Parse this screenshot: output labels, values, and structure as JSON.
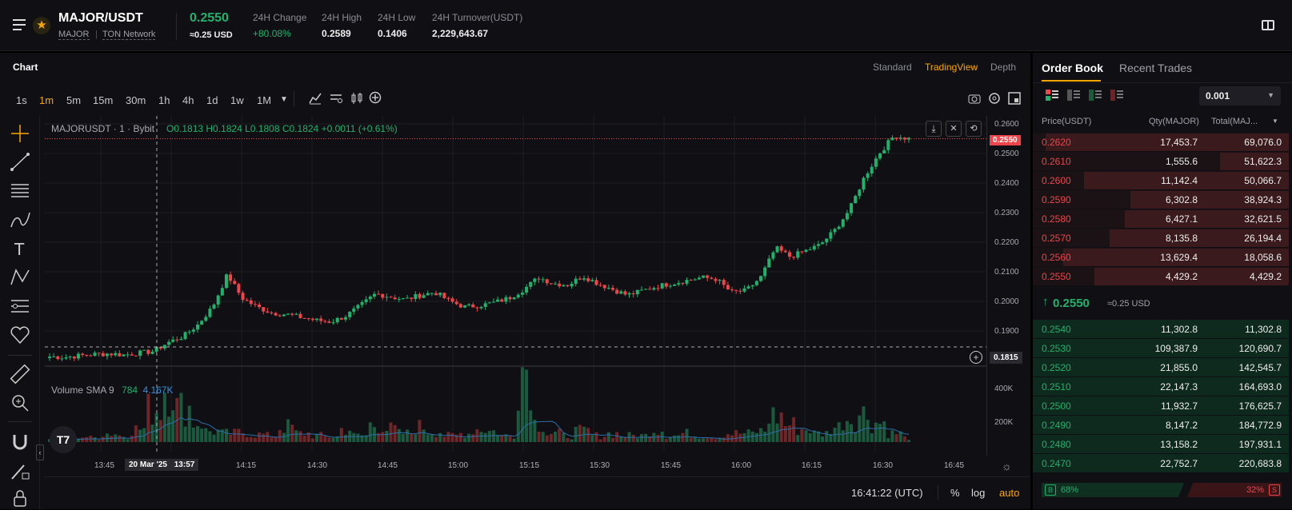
{
  "header": {
    "pair": "MAJOR/USDT",
    "base_name": "MAJOR",
    "network": "TON Network",
    "price": "0.2550",
    "price_usd": "≈0.25 USD",
    "stats": [
      {
        "label": "24H Change",
        "value": "+80.08%"
      },
      {
        "label": "24H High",
        "value": "0.2589"
      },
      {
        "label": "24H Low",
        "value": "0.1406"
      },
      {
        "label": "24H Turnover(USDT)",
        "value": "2,229,643.67"
      }
    ]
  },
  "chart_panel": {
    "title": "Chart",
    "views": [
      "Standard",
      "TradingView",
      "Depth"
    ],
    "active_view": "TradingView",
    "timeframes": [
      "1s",
      "1m",
      "5m",
      "15m",
      "30m",
      "1h",
      "4h",
      "1d",
      "1w",
      "1M"
    ],
    "active_timeframe": "1m",
    "legend_symbol": "MAJORUSDT · 1 · Bybit",
    "ohlc": {
      "o": "O0.1813",
      "h": "H0.1824",
      "l": "L0.1808",
      "c": "C0.1824",
      "chg": "+0.0011 (+0.61%)"
    },
    "volume_label": "Volume SMA 9",
    "volume_val1": "784",
    "volume_val2": "4.167K",
    "last_price_tag": "0.2550",
    "crosshair_price_tag": "0.1815",
    "crosshair_time_label": "20 Mar '25",
    "crosshair_time_val": "13:57",
    "clock": "16:41:22 (UTC)",
    "scale_pct": "%",
    "scale_log": "log",
    "scale_auto": "auto"
  },
  "chart_data": {
    "type": "candlestick",
    "x_ticks": [
      "13:45",
      "14:15",
      "14:30",
      "14:45",
      "15:00",
      "15:15",
      "15:30",
      "15:45",
      "16:00",
      "16:15",
      "16:30",
      "16:45"
    ],
    "y_ticks": [
      "0.2600",
      "0.2500",
      "0.2400",
      "0.2300",
      "0.2200",
      "0.2100",
      "0.2000",
      "0.1900"
    ],
    "volume_ticks": [
      "400K",
      "200K"
    ],
    "ylim": [
      0.1815,
      0.26
    ],
    "close_path": [
      0.1812,
      0.181,
      0.1815,
      0.182,
      0.1822,
      0.1818,
      0.1824,
      0.183,
      0.186,
      0.188,
      0.192,
      0.198,
      0.209,
      0.201,
      0.198,
      0.196,
      0.1955,
      0.1945,
      0.1935,
      0.193,
      0.195,
      0.1985,
      0.2025,
      0.2015,
      0.2005,
      0.202,
      0.203,
      0.2,
      0.198,
      0.1985,
      0.1995,
      0.201,
      0.204,
      0.208,
      0.206,
      0.2055,
      0.2085,
      0.206,
      0.204,
      0.202,
      0.2035,
      0.205,
      0.206,
      0.207,
      0.208,
      0.2075,
      0.203,
      0.2035,
      0.208,
      0.218,
      0.215,
      0.217,
      0.219,
      0.224,
      0.231,
      0.242,
      0.25,
      0.256,
      0.255
    ],
    "volume_path": [
      20,
      15,
      25,
      20,
      40,
      30,
      60,
      150,
      260,
      160,
      90,
      50,
      40,
      45,
      35,
      30,
      70,
      40,
      30,
      25,
      60,
      30,
      80,
      60,
      40,
      70,
      50,
      30,
      40,
      60,
      50,
      30,
      350,
      90,
      40,
      30,
      50,
      30,
      40,
      30,
      30,
      60,
      30,
      40,
      30,
      25,
      40,
      40,
      50,
      120,
      80,
      60,
      40,
      70,
      110,
      130,
      90,
      40,
      20
    ]
  },
  "order_book": {
    "tabs": [
      "Order Book",
      "Recent Trades"
    ],
    "active_tab": "Order Book",
    "precision": "0.001",
    "columns": [
      "Price(USDT)",
      "Qty(MAJOR)",
      "Total(MAJ..."
    ],
    "asks": [
      {
        "price": "0.2620",
        "qty": "17,453.7",
        "total": "69,076.0",
        "depth": 0.95
      },
      {
        "price": "0.2610",
        "qty": "1,555.6",
        "total": "51,622.3",
        "depth": 0.27
      },
      {
        "price": "0.2600",
        "qty": "11,142.4",
        "total": "50,066.7",
        "depth": 0.8
      },
      {
        "price": "0.2590",
        "qty": "6,302.8",
        "total": "38,924.3",
        "depth": 0.62
      },
      {
        "price": "0.2580",
        "qty": "6,427.1",
        "total": "32,621.5",
        "depth": 0.64
      },
      {
        "price": "0.2570",
        "qty": "8,135.8",
        "total": "26,194.4",
        "depth": 0.7
      },
      {
        "price": "0.2560",
        "qty": "13,629.4",
        "total": "18,058.6",
        "depth": 0.88
      },
      {
        "price": "0.2550",
        "qty": "4,429.2",
        "total": "4,429.2",
        "depth": 0.76
      }
    ],
    "mid_price": "0.2550",
    "mid_usd": "≈0.25 USD",
    "bids": [
      {
        "price": "0.2540",
        "qty": "11,302.8",
        "total": "11,302.8"
      },
      {
        "price": "0.2530",
        "qty": "109,387.9",
        "total": "120,690.7"
      },
      {
        "price": "0.2520",
        "qty": "21,855.0",
        "total": "142,545.7"
      },
      {
        "price": "0.2510",
        "qty": "22,147.3",
        "total": "164,693.0"
      },
      {
        "price": "0.2500",
        "qty": "11,932.7",
        "total": "176,625.7"
      },
      {
        "price": "0.2490",
        "qty": "8,147.2",
        "total": "184,772.9"
      },
      {
        "price": "0.2480",
        "qty": "13,158.2",
        "total": "197,931.1"
      },
      {
        "price": "0.2470",
        "qty": "22,752.7",
        "total": "220,683.8"
      }
    ],
    "buy_label": "B",
    "buy_pct": "68%",
    "sell_pct": "32%",
    "sell_label": "S"
  },
  "colors": {
    "up": "#20b26c",
    "down": "#ef454a",
    "accent": "#f7a600",
    "bg": "#101014"
  }
}
